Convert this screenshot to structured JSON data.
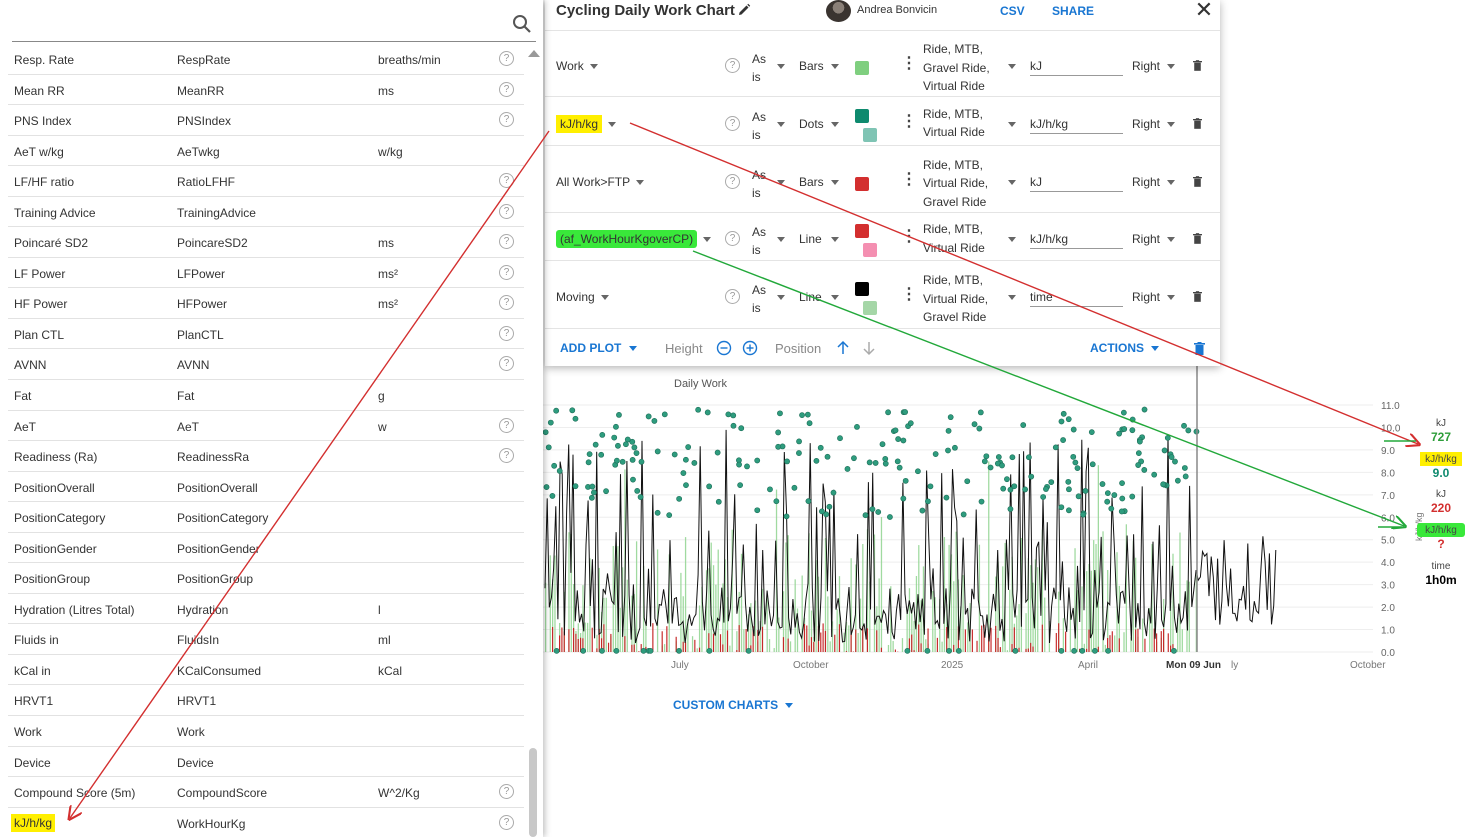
{
  "field_list": {
    "rows": [
      {
        "name": "Resp. Rate",
        "code": "RespRate",
        "unit": "breaths/min",
        "help": true
      },
      {
        "name": "Mean RR",
        "code": "MeanRR",
        "unit": "ms",
        "help": true
      },
      {
        "name": "PNS Index",
        "code": "PNSIndex",
        "unit": "",
        "help": true
      },
      {
        "name": "AeT w/kg",
        "code": "AeTwkg",
        "unit": "w/kg",
        "help": false
      },
      {
        "name": "LF/HF ratio",
        "code": "RatioLFHF",
        "unit": "",
        "help": true
      },
      {
        "name": "Training Advice",
        "code": "TrainingAdvice",
        "unit": "",
        "help": true
      },
      {
        "name": "Poincaré SD2",
        "code": "PoincareSD2",
        "unit": "ms",
        "help": true
      },
      {
        "name": "LF Power",
        "code": "LFPower",
        "unit": "ms²",
        "help": true
      },
      {
        "name": "HF Power",
        "code": "HFPower",
        "unit": "ms²",
        "help": true
      },
      {
        "name": "Plan CTL",
        "code": "PlanCTL",
        "unit": "",
        "help": true
      },
      {
        "name": "AVNN",
        "code": "AVNN",
        "unit": "",
        "help": true
      },
      {
        "name": "Fat",
        "code": "Fat",
        "unit": "g",
        "help": false
      },
      {
        "name": "AeT",
        "code": "AeT",
        "unit": "w",
        "help": true
      },
      {
        "name": "Readiness (Ra)",
        "code": "ReadinessRa",
        "unit": "",
        "help": true
      },
      {
        "name": "PositionOverall",
        "code": "PositionOverall",
        "unit": "",
        "help": false
      },
      {
        "name": "PositionCategory",
        "code": "PositionCategory",
        "unit": "",
        "help": false
      },
      {
        "name": "PositionGender",
        "code": "PositionGender",
        "unit": "",
        "help": false
      },
      {
        "name": "PositionGroup",
        "code": "PositionGroup",
        "unit": "",
        "help": false
      },
      {
        "name": "Hydration (Litres Total)",
        "code": "Hydration",
        "unit": "l",
        "help": false
      },
      {
        "name": "Fluids in",
        "code": "FluidsIn",
        "unit": "ml",
        "help": false
      },
      {
        "name": "kCal in",
        "code": "KCalConsumed",
        "unit": "kCal",
        "help": false
      },
      {
        "name": "HRVT1",
        "code": "HRVT1",
        "unit": "",
        "help": false
      },
      {
        "name": "Work",
        "code": "Work",
        "unit": "",
        "help": false
      },
      {
        "name": "Device",
        "code": "Device",
        "unit": "",
        "help": false
      },
      {
        "name": "Compound Score (5m)",
        "code": "CompoundScore",
        "unit": "W^2/Kg",
        "help": true
      },
      {
        "name": "kJ/h/kg",
        "code": "WorkHourKg",
        "unit": "",
        "help": true
      }
    ]
  },
  "editor": {
    "title": "Cycling Daily Work Chart",
    "user_name": "Andrea Bonvicin",
    "csv_label": "CSV",
    "share_label": "SHARE",
    "plots": [
      {
        "field": "Work",
        "mode": "As is",
        "kind": "Bars",
        "colors": [
          "#7fcf7f"
        ],
        "types": [
          "Ride, MTB,",
          "Gravel Ride,",
          "Virtual Ride"
        ],
        "unit": "kJ",
        "axis": "Right",
        "highlight": "none"
      },
      {
        "field": "kJ/h/kg",
        "mode": "As is",
        "kind": "Dots",
        "colors": [
          "#0e8a6e",
          "#7fc4b4"
        ],
        "types": [
          "Ride, MTB,",
          "Virtual Ride"
        ],
        "unit": "kJ/h/kg",
        "axis": "Right",
        "highlight": "yellow"
      },
      {
        "field": "All Work>FTP",
        "mode": "As is",
        "kind": "Bars",
        "colors": [
          "#d32f2f"
        ],
        "types": [
          "Ride, MTB,",
          "Virtual Ride,",
          "Gravel Ride"
        ],
        "unit": "kJ",
        "axis": "Right",
        "highlight": "none"
      },
      {
        "field": "(af_WorkHourKgoverCP)",
        "mode": "As is",
        "kind": "Line",
        "colors": [
          "#d32f2f",
          "#f48fb1"
        ],
        "types": [
          "Ride, MTB,",
          "Virtual Ride"
        ],
        "unit": "kJ/h/kg",
        "axis": "Right",
        "highlight": "green"
      },
      {
        "field": "Moving",
        "mode": "As is",
        "kind": "Line",
        "colors": [
          "#000000",
          "#a5d6a7"
        ],
        "types": [
          "Ride, MTB,",
          "Virtual Ride,",
          "Gravel Ride"
        ],
        "unit": "time",
        "axis": "Right",
        "highlight": "none"
      }
    ],
    "add_plot_label": "ADD PLOT",
    "height_label": "Height",
    "position_label": "Position",
    "actions_label": "ACTIONS"
  },
  "chart": {
    "custom_charts_label": "CUSTOM CHARTS",
    "legend": [
      {
        "unit": "kJ",
        "value": "727",
        "color": "#2e9e3a"
      },
      {
        "unit": "kJ/h/kg",
        "value": "9.0",
        "color": "#0e8a6e"
      },
      {
        "unit": "kJ",
        "value": "220",
        "color": "#d32f2f"
      },
      {
        "unit": "kJ/h/kg",
        "value": "?",
        "color": "#d32f2f"
      },
      {
        "unit": "time",
        "value": "1h0m",
        "color": "#000000"
      }
    ],
    "axis_side_label": "kJ/h/kg"
  },
  "chart_data": {
    "type": "bar",
    "title": "Daily Work",
    "xlabel": "",
    "ylabel": "",
    "x_ticks": [
      "July",
      "October",
      "2025",
      "April",
      "Mon 09 Jun",
      "ly",
      "October"
    ],
    "y_ticks": [
      "0.0",
      "1.0",
      "2.0",
      "3.0",
      "4.0",
      "5.0",
      "6.0",
      "7.0",
      "8.0",
      "9.0",
      "10.0",
      "11.0"
    ],
    "ylim": [
      0,
      11
    ],
    "cursor_label": "Mon 09 Jun",
    "series": [
      {
        "name": "Work",
        "style": "bars",
        "color": "#7fcf7f"
      },
      {
        "name": "kJ/h/kg",
        "style": "dots",
        "color": "#0e8a6e"
      },
      {
        "name": "All Work>FTP",
        "style": "bars",
        "color": "#d32f2f"
      },
      {
        "name": "(af_WorkHourKgoverCP)",
        "style": "line",
        "color": "#000000"
      }
    ]
  }
}
